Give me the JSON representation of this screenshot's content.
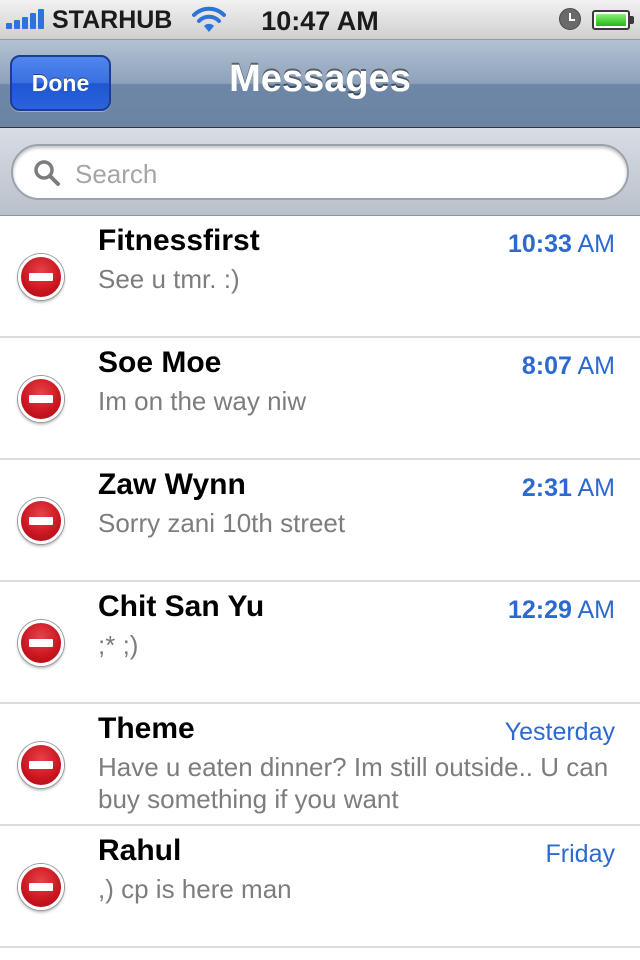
{
  "status_bar": {
    "carrier": "STARHUB",
    "time": "10:47 AM",
    "icons": [
      "signal-bars-icon",
      "wifi-icon",
      "clock-icon",
      "battery-icon"
    ],
    "battery_color": "#22b814"
  },
  "nav": {
    "done_label": "Done",
    "title": "Messages"
  },
  "search": {
    "placeholder": "Search"
  },
  "colors": {
    "accent_blue": "#2c6ad2",
    "delete_red": "#c9151f",
    "nav_bar": "#8ea2bb"
  },
  "messages": [
    {
      "sender": "Fitnessfirst",
      "preview": "See u tmr. :)",
      "time_main": "10:33",
      "time_suffix": "AM"
    },
    {
      "sender": "Soe Moe",
      "preview": "Im on the way niw",
      "time_main": "8:07",
      "time_suffix": "AM"
    },
    {
      "sender": "Zaw Wynn",
      "preview": "Sorry zani 10th street",
      "time_main": "2:31",
      "time_suffix": "AM"
    },
    {
      "sender": "Chit San Yu",
      "preview": ";* ;)",
      "time_main": "12:29",
      "time_suffix": "AM"
    },
    {
      "sender": "Theme",
      "preview": "Have u eaten dinner? Im still outside.. U can buy something if you want",
      "time_main": "",
      "time_suffix": "Yesterday"
    },
    {
      "sender": "Rahul",
      "preview": ",) cp is here man",
      "time_main": "",
      "time_suffix": "Friday"
    }
  ]
}
